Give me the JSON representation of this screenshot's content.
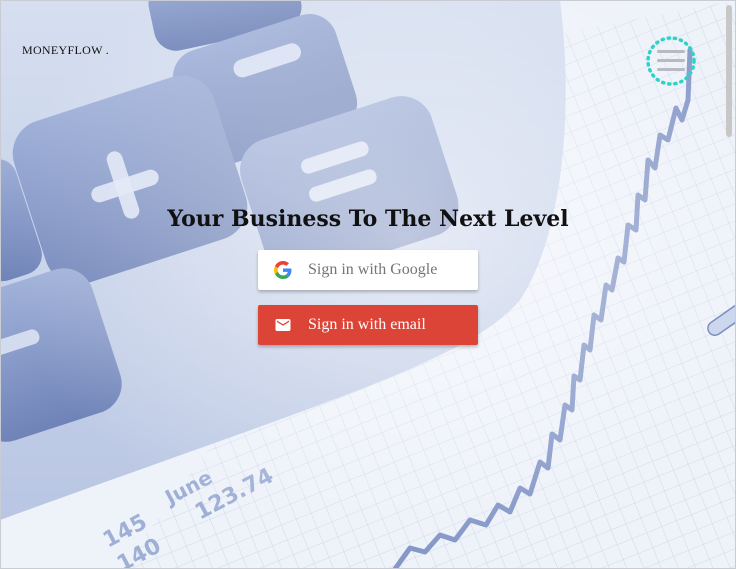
{
  "brand": {
    "name": "MONEYFLOW ."
  },
  "header": {
    "menu_icon": "hamburger-menu-icon"
  },
  "hero": {
    "title": "Your Business To The Next Level"
  },
  "auth": {
    "google": {
      "label": "Sign in with Google",
      "icon": "google-g-icon"
    },
    "email": {
      "label": "Sign in with email",
      "icon": "mail-icon"
    }
  },
  "background": {
    "description_icon": "calculator-chart-background",
    "tick_labels": [
      "145",
      "140",
      "June",
      "123.74"
    ]
  },
  "colors": {
    "email_button": "#db4437",
    "google_button": "#ffffff",
    "menu_accent": "#2ed3c6",
    "scene_blue": "#7f94c7"
  }
}
